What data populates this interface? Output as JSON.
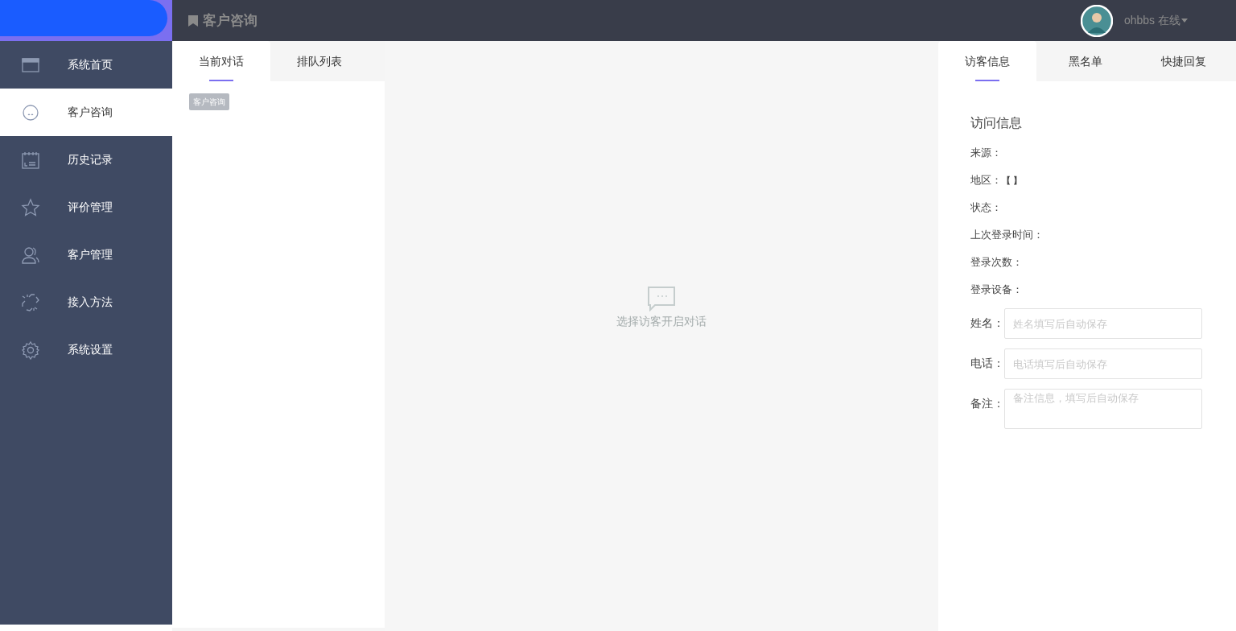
{
  "header": {
    "title": "客户咨询",
    "user": "ohbbs 在线"
  },
  "sidebar": {
    "items": [
      {
        "label": "系统首页",
        "selected": false
      },
      {
        "label": "客户咨询",
        "selected": true
      },
      {
        "label": "历史记录",
        "selected": false
      },
      {
        "label": "评价管理",
        "selected": false
      },
      {
        "label": "客户管理",
        "selected": false
      },
      {
        "label": "接入方法",
        "selected": false
      },
      {
        "label": "系统设置",
        "selected": false
      }
    ]
  },
  "tooltip": "客户咨询",
  "conversation_tabs": [
    {
      "label": "当前对话",
      "selected": true
    },
    {
      "label": "排队列表",
      "selected": false
    }
  ],
  "empty_state": "选择访客开启对话",
  "info_tabs": [
    {
      "label": "访客信息",
      "selected": true
    },
    {
      "label": "黑名单",
      "selected": false
    },
    {
      "label": "快捷回复",
      "selected": false
    }
  ],
  "visit_info": {
    "heading": "访问信息",
    "fields": [
      {
        "label": "来源："
      },
      {
        "label": "地区：",
        "value": "【 】"
      },
      {
        "label": "状态："
      },
      {
        "label": "上次登录时间："
      },
      {
        "label": "登录次数："
      },
      {
        "label": "登录设备："
      }
    ]
  },
  "form": [
    {
      "kind": "input",
      "label": "姓名：",
      "placeholder": "姓名填写后自动保存"
    },
    {
      "kind": "input",
      "label": "电话：",
      "placeholder": "电话填写后自动保存"
    },
    {
      "kind": "textarea",
      "label": "备注：",
      "placeholder": "备注信息，填写后自动保存"
    }
  ]
}
